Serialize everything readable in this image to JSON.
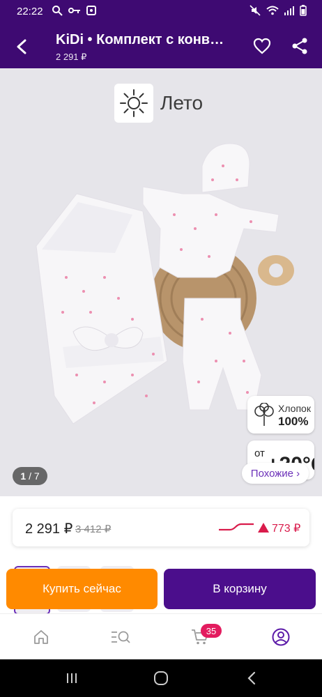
{
  "status_bar": {
    "time": "22:22",
    "battery_icon": "battery-icon",
    "wifi_icon": "wifi-icon"
  },
  "header": {
    "title": "KiDi • Комплект с конв…",
    "subtitle": "2 291 ₽",
    "back_icon": "back-arrow-icon",
    "favorite_icon": "heart-icon",
    "share_icon": "share-icon"
  },
  "gallery": {
    "season_label": "Лето",
    "season_icon": "sun-icon",
    "cotton_label": "Хлопок",
    "cotton_value": "100%",
    "temp_prefix": "от",
    "temp_value": "+20°C",
    "counter_current": "1",
    "counter_total": "/ 7",
    "similar_button": "Похожие ›"
  },
  "price": {
    "current": "2 291 ₽",
    "old": "3 412 ₽",
    "delta": "773 ₽",
    "colors": {
      "accent": "#4b0e8c",
      "buy": "#ff8a00",
      "down": "#d91b4b"
    }
  },
  "actions": {
    "buy_now": "Купить сейчас",
    "add_to_cart": "В корзину"
  },
  "bottom_nav": {
    "home_icon": "home-icon",
    "catalog_icon": "catalog-search-icon",
    "cart_icon": "cart-icon",
    "cart_count": "35",
    "profile_icon": "profile-icon"
  }
}
